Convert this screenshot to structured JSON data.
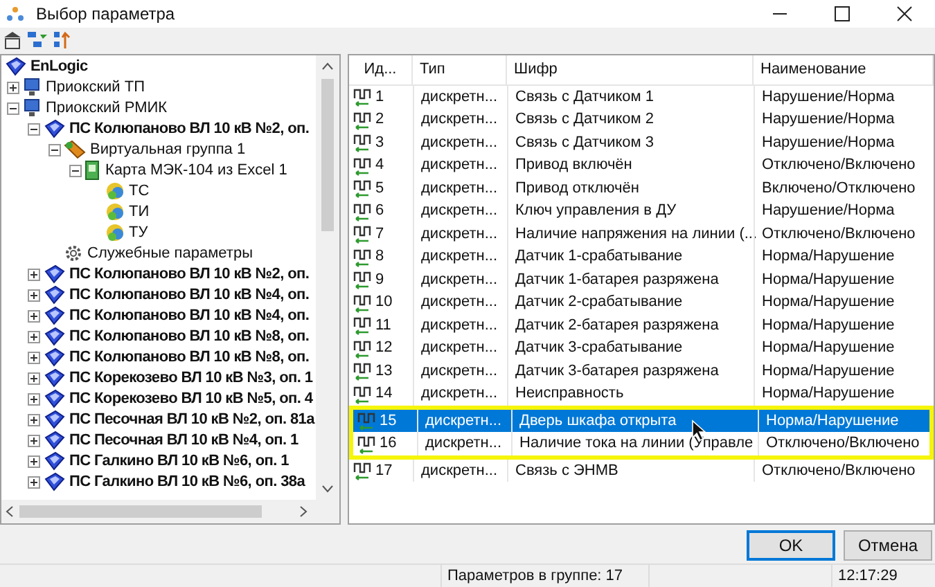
{
  "window": {
    "title": "Выбор параметра"
  },
  "tree": {
    "label": "EnLogic",
    "kind": "root",
    "children": [
      {
        "label": "Приокский ТП",
        "kind": "computer",
        "expanded": false
      },
      {
        "label": "Приокский РМИК",
        "kind": "computer",
        "expanded": true,
        "children": [
          {
            "label": "ПС Колюпаново ВЛ 10 кВ №2, оп.",
            "kind": "device",
            "expanded": true,
            "children": [
              {
                "label": "Виртуальная группа 1",
                "kind": "group",
                "expanded": true,
                "children": [
                  {
                    "label": "Карта МЭК-104 из Excel 1",
                    "kind": "card",
                    "expanded": true,
                    "children": [
                      {
                        "label": "ТС",
                        "kind": "ball"
                      },
                      {
                        "label": "ТИ",
                        "kind": "ball"
                      },
                      {
                        "label": "ТУ",
                        "kind": "ball"
                      }
                    ]
                  }
                ]
              },
              {
                "label": "Служебные параметры",
                "kind": "gear"
              }
            ]
          },
          {
            "label": "ПС Колюпаново ВЛ 10 кВ №2, оп.",
            "kind": "device",
            "expanded": false
          },
          {
            "label": "ПС Колюпаново ВЛ 10 кВ №4, оп.",
            "kind": "device",
            "expanded": false
          },
          {
            "label": "ПС Колюпаново ВЛ 10 кВ №4, оп.",
            "kind": "device",
            "expanded": false
          },
          {
            "label": "ПС Колюпаново ВЛ 10 кВ №8, оп.",
            "kind": "device",
            "expanded": false
          },
          {
            "label": "ПС Колюпаново ВЛ 10 кВ №8, оп.",
            "kind": "device",
            "expanded": false
          },
          {
            "label": "ПС Корекозево ВЛ 10 кВ №3, оп. 1",
            "kind": "device",
            "expanded": false
          },
          {
            "label": "ПС Корекозево ВЛ 10 кВ №5, оп. 4",
            "kind": "device",
            "expanded": false
          },
          {
            "label": "ПС Песочная ВЛ 10 кВ №2, оп. 81а",
            "kind": "device",
            "expanded": false
          },
          {
            "label": "ПС Песочная ВЛ 10 кВ №4, оп. 1",
            "kind": "device",
            "expanded": false
          },
          {
            "label": "ПС Галкино ВЛ 10 кВ №6, оп. 1",
            "kind": "device",
            "expanded": false
          },
          {
            "label": "ПС Галкино ВЛ 10 кВ №6, оп. 38а",
            "kind": "device",
            "expanded": false
          }
        ]
      }
    ]
  },
  "table": {
    "columns": [
      "Ид...",
      "Тип",
      "Шифр",
      "Наименование"
    ],
    "rows": [
      {
        "cells": [
          "1",
          "дискретн...",
          "Связь с Датчиком 1",
          "Нарушение/Норма"
        ],
        "selected": false,
        "highlighted": false
      },
      {
        "cells": [
          "2",
          "дискретн...",
          "Связь с Датчиком 2",
          "Нарушение/Норма"
        ],
        "selected": false,
        "highlighted": false
      },
      {
        "cells": [
          "3",
          "дискретн...",
          "Связь с Датчиком 3",
          "Нарушение/Норма"
        ],
        "selected": false,
        "highlighted": false
      },
      {
        "cells": [
          "4",
          "дискретн...",
          "Привод включён",
          "Отключено/Включено"
        ],
        "selected": false,
        "highlighted": false
      },
      {
        "cells": [
          "5",
          "дискретн...",
          "Привод отключён",
          "Включено/Отключено"
        ],
        "selected": false,
        "highlighted": false
      },
      {
        "cells": [
          "6",
          "дискретн...",
          "Ключ управления в ДУ",
          "Нарушение/Норма"
        ],
        "selected": false,
        "highlighted": false
      },
      {
        "cells": [
          "7",
          "дискретн...",
          "Наличие напряжения на линии (...",
          "Отключено/Включено"
        ],
        "selected": false,
        "highlighted": false
      },
      {
        "cells": [
          "8",
          "дискретн...",
          "Датчик 1-срабатывание",
          "Норма/Нарушение"
        ],
        "selected": false,
        "highlighted": false
      },
      {
        "cells": [
          "9",
          "дискретн...",
          "Датчик 1-батарея разряжена",
          "Норма/Нарушение"
        ],
        "selected": false,
        "highlighted": false
      },
      {
        "cells": [
          "10",
          "дискретн...",
          "Датчик 2-срабатывание",
          "Норма/Нарушение"
        ],
        "selected": false,
        "highlighted": false
      },
      {
        "cells": [
          "11",
          "дискретн...",
          "Датчик 2-батарея разряжена",
          "Норма/Нарушение"
        ],
        "selected": false,
        "highlighted": false
      },
      {
        "cells": [
          "12",
          "дискретн...",
          "Датчик 3-срабатывание",
          "Норма/Нарушение"
        ],
        "selected": false,
        "highlighted": false
      },
      {
        "cells": [
          "13",
          "дискретн...",
          "Датчик 3-батарея разряжена",
          "Норма/Нарушение"
        ],
        "selected": false,
        "highlighted": false
      },
      {
        "cells": [
          "14",
          "дискретн...",
          "Неисправность",
          "Норма/Нарушение"
        ],
        "selected": false,
        "highlighted": false
      },
      {
        "cells": [
          "15",
          "дискретн...",
          "Дверь шкафа открыта",
          "Норма/Нарушение"
        ],
        "selected": true,
        "highlighted": true
      },
      {
        "cells": [
          "16",
          "дискретн...",
          "Наличие тока на линии (Управле",
          "Отключено/Включено"
        ],
        "selected": false,
        "highlighted": true
      },
      {
        "cells": [
          "17",
          "дискретн...",
          "Связь с ЭНМВ",
          "Отключено/Включено"
        ],
        "selected": false,
        "highlighted": false
      }
    ]
  },
  "buttons": [
    {
      "label": "OK",
      "focused": true
    },
    {
      "label": "Отмена",
      "focused": false
    }
  ],
  "status_bar": {
    "count": "Параметров в группе: 17",
    "time": "12:17:29"
  }
}
